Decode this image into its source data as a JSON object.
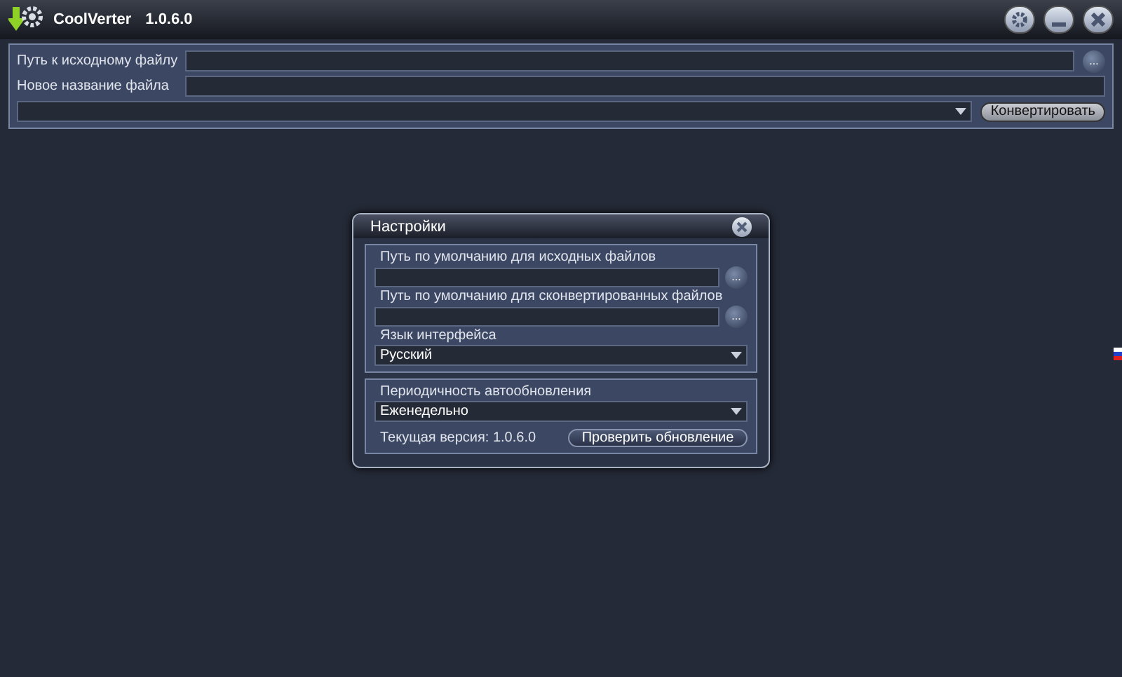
{
  "window": {
    "title": "CoolVerter",
    "version": "1.0.6.0"
  },
  "main": {
    "source_label": "Путь к исходному файлу",
    "browse": "...",
    "name_label": "Новое название файла",
    "convert_button": "Конвертировать"
  },
  "settings": {
    "title": "Настройки",
    "source_dir_label": "Путь по умолчанию для исходных файлов",
    "source_browse": "...",
    "output_dir_label": "Путь по умолчанию для сконвертированных файлов",
    "output_browse": "...",
    "language_label": "Язык интерфейса",
    "language": "Русский",
    "update_label": "Периодичность автообновления",
    "update_period": "Еженедельно",
    "version_text": "Текущая версия: 1.0.6.0",
    "check_button": "Проверить обновление"
  }
}
